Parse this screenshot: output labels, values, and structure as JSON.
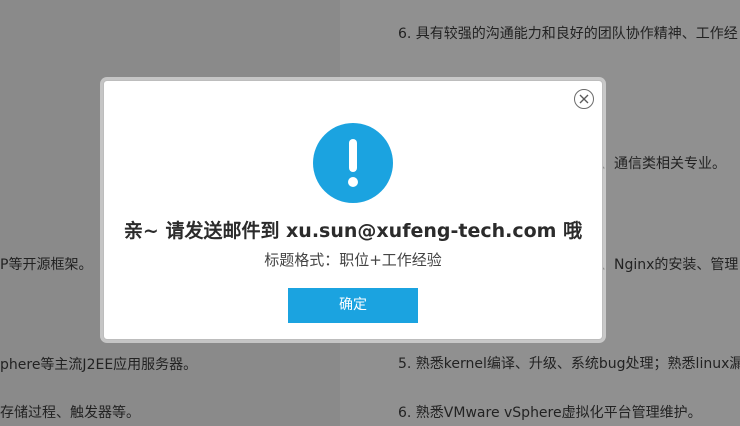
{
  "background": {
    "left_lines": [
      "P等开源框架。",
      "phere等主流J2EE应用服务器。",
      "存储过程、触发器等。"
    ],
    "right_lines": [
      "6.   具有较强的沟通能力和良好的团队协作精神、工作经",
      "、通信类相关专业。",
      "、Nginx的安装、管理",
      "5.   熟悉kernel编译、升级、系统bug处理；熟悉linux漏",
      "6.   熟悉VMware vSphere虚拟化平台管理维护。"
    ]
  },
  "dialog": {
    "icon": "exclamation-icon",
    "close_icon": "close-icon",
    "title": "亲~ 请发送邮件到 xu.sun@xufeng-tech.com 哦",
    "subtitle": "标题格式：职位+工作经验",
    "confirm_label": "确定"
  },
  "colors": {
    "accent": "#1ba3e0",
    "overlay": "#8d8d8d"
  }
}
